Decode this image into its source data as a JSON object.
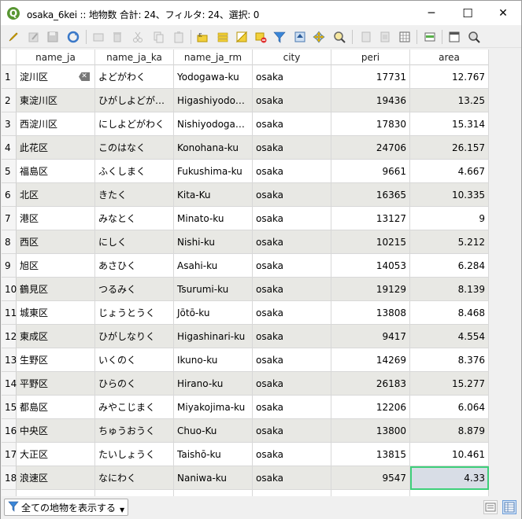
{
  "window": {
    "title": "osaka_6kei :: 地物数 合計: 24、フィルタ: 24、選択: 0",
    "app_icon_letter": "Q",
    "minimize": "─",
    "maximize": "☐",
    "close": "✕"
  },
  "toolbar": {
    "icons": [
      "pencil-icon",
      "multi-edit-icon",
      "save-icon",
      "reload-icon",
      "add-feature-icon",
      "delete-icon",
      "cut-icon",
      "copy-icon",
      "paste-icon",
      "expression-select-icon",
      "select-all-icon",
      "invert-selection-icon",
      "deselect-icon",
      "filter-icon",
      "move-to-top-icon",
      "pan-to-selection-icon",
      "zoom-to-selection-icon",
      "new-field-icon",
      "delete-field-icon",
      "field-calculator-icon",
      "conditional-format-icon",
      "dock-icon",
      "actions-icon"
    ]
  },
  "columns": [
    "name_ja",
    "name_ja_ka",
    "name_ja_rm",
    "city",
    "peri",
    "area"
  ],
  "rows": [
    {
      "id": "1",
      "name_ja": "淀川区",
      "name_ja_ka": "よどがわく",
      "name_ja_rm": "Yodogawa-ku",
      "city": "osaka",
      "peri": "17731",
      "area": "12.767"
    },
    {
      "id": "2",
      "name_ja": "東淀川区",
      "name_ja_ka": "ひがしよどがわく",
      "name_ja_rm": "Higashiyodoga...",
      "city": "osaka",
      "peri": "19436",
      "area": "13.25"
    },
    {
      "id": "3",
      "name_ja": "西淀川区",
      "name_ja_ka": "にしよどがわく",
      "name_ja_rm": "Nishiyodogawa...",
      "city": "osaka",
      "peri": "17830",
      "area": "15.314"
    },
    {
      "id": "4",
      "name_ja": "此花区",
      "name_ja_ka": "このはなく",
      "name_ja_rm": "Konohana-ku",
      "city": "osaka",
      "peri": "24706",
      "area": "26.157"
    },
    {
      "id": "5",
      "name_ja": "福島区",
      "name_ja_ka": "ふくしまく",
      "name_ja_rm": "Fukushima-ku",
      "city": "osaka",
      "peri": "9661",
      "area": "4.667"
    },
    {
      "id": "6",
      "name_ja": "北区",
      "name_ja_ka": "きたく",
      "name_ja_rm": "Kita-Ku",
      "city": "osaka",
      "peri": "16365",
      "area": "10.335"
    },
    {
      "id": "7",
      "name_ja": "港区",
      "name_ja_ka": "みなとく",
      "name_ja_rm": "Minato-ku",
      "city": "osaka",
      "peri": "13127",
      "area": "9"
    },
    {
      "id": "8",
      "name_ja": "西区",
      "name_ja_ka": "にしく",
      "name_ja_rm": "Nishi-ku",
      "city": "osaka",
      "peri": "10215",
      "area": "5.212"
    },
    {
      "id": "9",
      "name_ja": "旭区",
      "name_ja_ka": "あさひく",
      "name_ja_rm": "Asahi-ku",
      "city": "osaka",
      "peri": "14053",
      "area": "6.284"
    },
    {
      "id": "10",
      "name_ja": "鶴見区",
      "name_ja_ka": "つるみく",
      "name_ja_rm": "Tsurumi-ku",
      "city": "osaka",
      "peri": "19129",
      "area": "8.139"
    },
    {
      "id": "11",
      "name_ja": "城東区",
      "name_ja_ka": "じょうとうく",
      "name_ja_rm": "Jōtō-ku",
      "city": "osaka",
      "peri": "13808",
      "area": "8.468"
    },
    {
      "id": "12",
      "name_ja": "東成区",
      "name_ja_ka": "ひがしなりく",
      "name_ja_rm": "Higashinari-ku",
      "city": "osaka",
      "peri": "9417",
      "area": "4.554"
    },
    {
      "id": "13",
      "name_ja": "生野区",
      "name_ja_ka": "いくのく",
      "name_ja_rm": "Ikuno-ku",
      "city": "osaka",
      "peri": "14269",
      "area": "8.376"
    },
    {
      "id": "14",
      "name_ja": "平野区",
      "name_ja_ka": "ひらのく",
      "name_ja_rm": "Hirano-ku",
      "city": "osaka",
      "peri": "26183",
      "area": "15.277"
    },
    {
      "id": "15",
      "name_ja": "都島区",
      "name_ja_ka": "みやこじまく",
      "name_ja_rm": "Miyakojima-ku",
      "city": "osaka",
      "peri": "12206",
      "area": "6.064"
    },
    {
      "id": "16",
      "name_ja": "中央区",
      "name_ja_ka": "ちゅうおうく",
      "name_ja_rm": "Chuo-Ku",
      "city": "osaka",
      "peri": "13800",
      "area": "8.879"
    },
    {
      "id": "17",
      "name_ja": "大正区",
      "name_ja_ka": "たいしょうく",
      "name_ja_rm": "Taishō-ku",
      "city": "osaka",
      "peri": "13815",
      "area": "10.461"
    },
    {
      "id": "18",
      "name_ja": "浪速区",
      "name_ja_ka": "なにわく",
      "name_ja_rm": "Naniwa-ku",
      "city": "osaka",
      "peri": "9547",
      "area": "4.33"
    }
  ],
  "status": {
    "filter_label": "全ての地物を表示する"
  },
  "colors": {
    "alt_row": "#e8e8e4",
    "selected_cell_border": "#3ecf7a"
  }
}
